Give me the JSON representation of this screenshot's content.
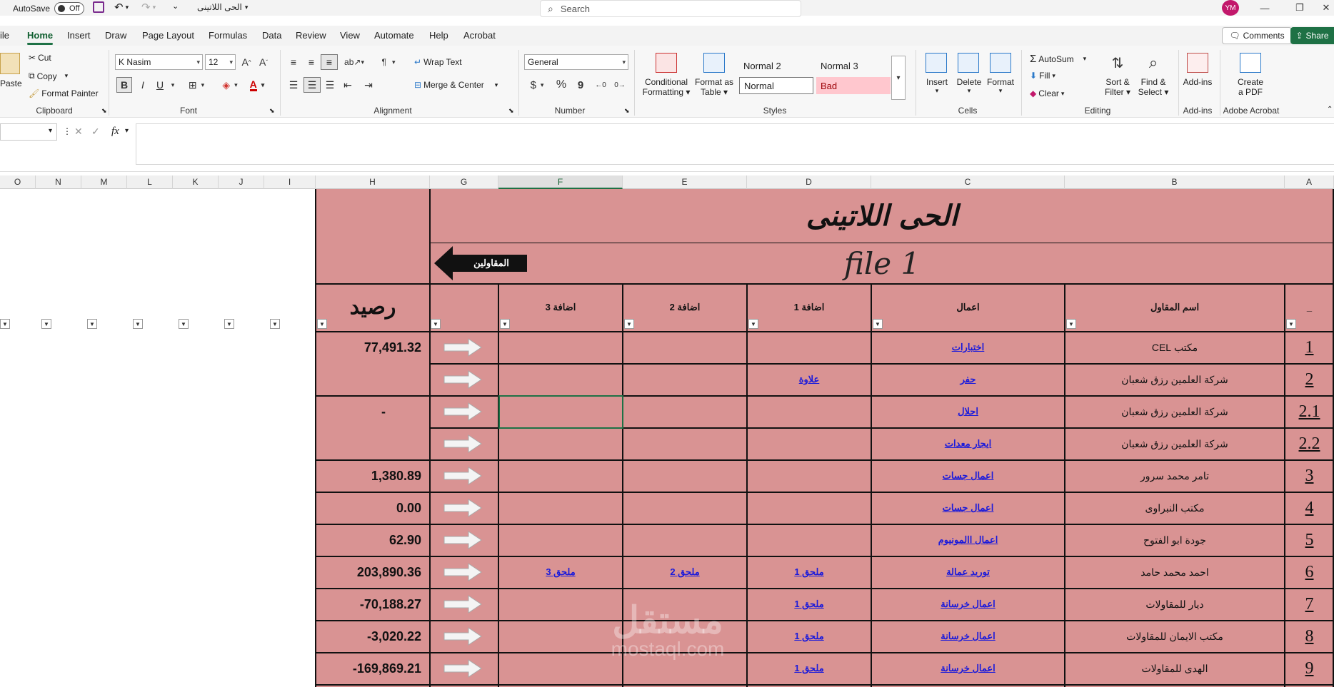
{
  "titlebar": {
    "autosave_label": "AutoSave",
    "autosave_state": "Off",
    "filename": "الحى اللاتينى",
    "search_placeholder": "Search",
    "user_initials": "YM"
  },
  "tabs": [
    "ile",
    "Home",
    "Insert",
    "Draw",
    "Page Layout",
    "Formulas",
    "Data",
    "Review",
    "View",
    "Automate",
    "Help",
    "Acrobat"
  ],
  "active_tab": "Home",
  "comments_label": "Comments",
  "share_label": "Share",
  "clipboard": {
    "paste": "Paste",
    "cut": "Cut",
    "copy": "Copy",
    "format_painter": "Format Painter",
    "group": "Clipboard"
  },
  "font": {
    "name": "K Nasim",
    "size": "12",
    "group": "Font",
    "bold": "B",
    "italic": "I",
    "underline": "U",
    "font_color_letter": "A"
  },
  "alignment": {
    "wrap_text": "Wrap Text",
    "merge_center": "Merge & Center",
    "group": "Alignment"
  },
  "number": {
    "format": "General",
    "group": "Number",
    "currency": "$",
    "percent": "%",
    "comma": "9"
  },
  "styles": {
    "conditional_formatting_1": "Conditional",
    "conditional_formatting_2": "Formatting",
    "format_as_table_1": "Format as",
    "format_as_table_2": "Table",
    "normal2": "Normal 2",
    "normal3": "Normal 3",
    "normal": "Normal",
    "bad": "Bad",
    "group": "Styles"
  },
  "cells": {
    "insert": "Insert",
    "delete": "Delete",
    "format": "Format",
    "group": "Cells"
  },
  "editing": {
    "autosum": "AutoSum",
    "fill": "Fill",
    "clear": "Clear",
    "sort_filter_1": "Sort &",
    "sort_filter_2": "Filter",
    "find_select_1": "Find &",
    "find_select_2": "Select",
    "group": "Editing"
  },
  "addins": {
    "label": "Add-ins",
    "group": "Add-ins"
  },
  "acrobat": {
    "create_1": "Create",
    "create_2": "a PDF",
    "group": "Adobe Acrobat"
  },
  "formula": {
    "fx": "fx"
  },
  "columns": [
    "O",
    "N",
    "M",
    "L",
    "K",
    "J",
    "I",
    "H",
    "G",
    "F",
    "E",
    "D",
    "C",
    "B",
    "A"
  ],
  "sheet": {
    "title": "الحى اللاتينى",
    "file_label": "file 1",
    "contractors_button": "المقاولين",
    "header": {
      "balance": "رصيد",
      "add3": "اضافة 3",
      "add2": "اضافة 2",
      "add1": "اضافة 1",
      "works": "اعمال",
      "contractor": "اسم المقاول",
      "a": "_"
    },
    "rows": [
      {
        "no": "1",
        "name": "مكتب CEL",
        "works": "اختبارات",
        "add1": "",
        "add2": "",
        "add3": "",
        "balance": "77,491.32"
      },
      {
        "no": "2",
        "name": "شركة العلمين رزق شعبان",
        "works": "حفر",
        "add1": "علاوة",
        "add2": "",
        "add3": "",
        "balance": ""
      },
      {
        "no": "2.1",
        "name": "شركة العلمين رزق شعبان",
        "works": "احلال",
        "add1": "",
        "add2": "",
        "add3": "",
        "balance": "-"
      },
      {
        "no": "2.2",
        "name": "شركة العلمين رزق شعبان",
        "works": "ايجار معدات",
        "add1": "",
        "add2": "",
        "add3": "",
        "balance": ""
      },
      {
        "no": "3",
        "name": "تامر محمد سرور",
        "works": "اعمال جسات",
        "add1": "",
        "add2": "",
        "add3": "",
        "balance": "1,380.89"
      },
      {
        "no": "4",
        "name": "مكتب النبراوى",
        "works": "اعمال جسات",
        "add1": "",
        "add2": "",
        "add3": "",
        "balance": "0.00"
      },
      {
        "no": "5",
        "name": "جودة ابو الفتوح",
        "works": "اعمال االمونيوم",
        "add1": "",
        "add2": "",
        "add3": "",
        "balance": "62.90"
      },
      {
        "no": "6",
        "name": "احمد محمد حامد",
        "works": "توريد عمالة",
        "add1": "ملحق 1",
        "add2": "ملحق 2",
        "add3": "ملحق 3",
        "balance": "203,890.36"
      },
      {
        "no": "7",
        "name": "ديار للمقاولات",
        "works": "اعمال خرسانة",
        "add1": "ملحق 1",
        "add2": "",
        "add3": "",
        "balance": "-70,188.27"
      },
      {
        "no": "8",
        "name": "مكتب الايمان للمقاولات",
        "works": "اعمال خرسانة",
        "add1": "ملحق 1",
        "add2": "",
        "add3": "",
        "balance": "-3,020.22"
      },
      {
        "no": "9",
        "name": "الهدى للمقاولات",
        "works": "اعمال خرسانة",
        "add1": "ملحق 1",
        "add2": "",
        "add3": "",
        "balance": "-169,869.21"
      }
    ]
  },
  "watermark": {
    "arabic": "مستقل",
    "latin": "mostaql.com"
  }
}
